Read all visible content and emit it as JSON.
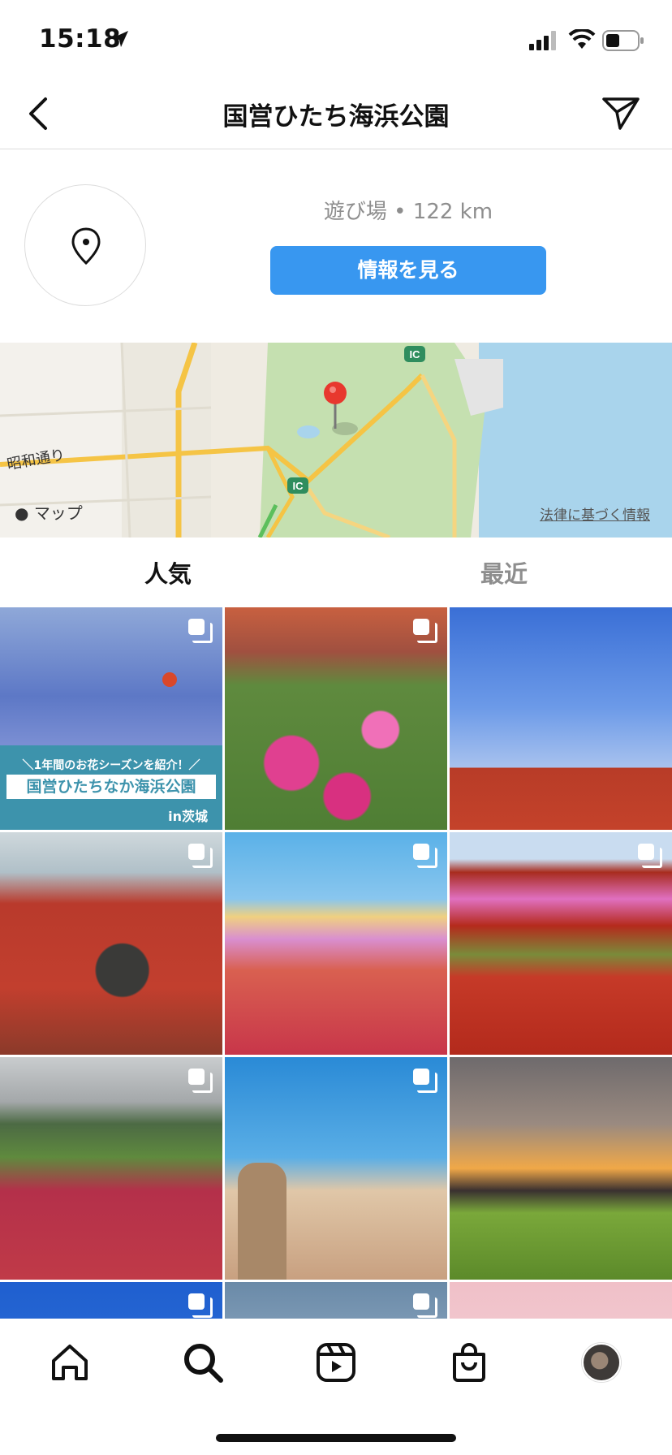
{
  "status_bar": {
    "time": "15:18",
    "icons": [
      "location-arrow-icon",
      "signal-icon",
      "wifi-icon",
      "battery-icon"
    ]
  },
  "header": {
    "title": "国営ひたち海浜公園",
    "back_icon": "chevron-left-icon",
    "share_icon": "paper-plane-icon"
  },
  "location": {
    "icon": "map-pin-icon",
    "subtitle": "遊び場 • 122 km",
    "info_button_label": "情報を見る"
  },
  "map": {
    "road_label": "昭和通り",
    "brand": "マップ",
    "legal_link": "法律に基づく情報",
    "badges": [
      "IC",
      "IC"
    ]
  },
  "tabs": [
    {
      "label": "人気",
      "active": true
    },
    {
      "label": "最近",
      "active": false
    }
  ],
  "posts": {
    "banner_top": "＼1年間のお花シーズンを紹介！／",
    "banner_main": "国営ひたちなか海浜公園",
    "banner_sub": "in茨城"
  },
  "colors": {
    "accent": "#3897f0",
    "secondary_text": "#8e8e8e",
    "map_pin": "#e8382e"
  },
  "bottom_nav": {
    "items": [
      "home-icon",
      "search-icon",
      "reels-icon",
      "shop-icon",
      "profile-avatar"
    ]
  }
}
